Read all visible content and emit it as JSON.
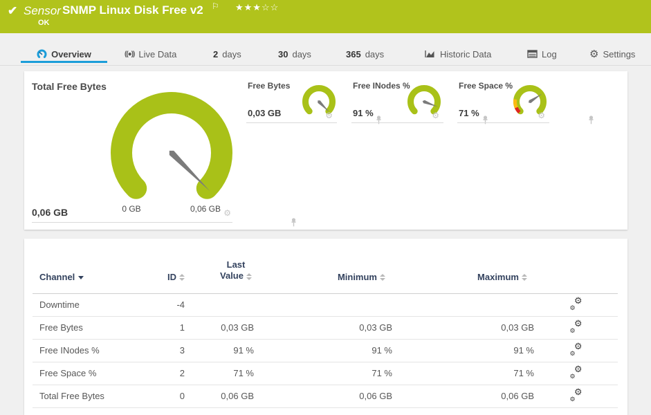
{
  "colors": {
    "brand_green": "#b1c31c",
    "accent_blue": "#1b9dd9",
    "gauge_green": "#a9c118",
    "warn_red": "#e02520",
    "warn_amber": "#fbba12",
    "needle_gray": "#7b7b7b"
  },
  "header": {
    "check_icon": "check-icon",
    "kind_label": "Sensor",
    "title": "SNMP Linux Disk Free v2",
    "flag_icon": "flag-icon",
    "stars": {
      "filled": 3,
      "total": 5
    },
    "status": "OK"
  },
  "tabs": [
    {
      "icon": "gauge-icon",
      "label": "Overview",
      "active": true
    },
    {
      "icon": "live-data-icon",
      "label": "Live Data"
    },
    {
      "prefix": "2",
      "label": "days"
    },
    {
      "prefix": "30",
      "label": "days"
    },
    {
      "prefix": "365",
      "label": "days"
    },
    {
      "icon": "historic-data-icon",
      "label": "Historic Data"
    },
    {
      "icon": "log-icon",
      "label": "Log"
    },
    {
      "icon": "settings-icon",
      "label": "Settings"
    }
  ],
  "gauges": {
    "primary": {
      "title": "Total Free Bytes",
      "value": "0,06 GB",
      "min_label": "0 GB",
      "max_label": "0,06 GB",
      "fraction": 1,
      "color": "#a9c118",
      "overlays": [],
      "footer_icons": [
        "gear-icon",
        "pin-icon"
      ]
    },
    "items": [
      {
        "title": "Free Bytes",
        "value": "0,03 GB",
        "fraction": 1,
        "color": "#a9c118",
        "overlays": [],
        "footer_icons": [
          "gear-icon",
          "pin-icon"
        ]
      },
      {
        "title": "Free INodes %",
        "value": "91 %",
        "fraction": 0.91,
        "color": "#a9c118",
        "overlays": [],
        "footer_icons": [
          "gear-icon",
          "pin-icon"
        ]
      },
      {
        "title": "Free Space %",
        "value": "71 %",
        "fraction": 0.71,
        "color": "#a9c118",
        "overlays": [
          {
            "color": "#e02520",
            "from": 0,
            "to": 0.08
          },
          {
            "color": "#fbba12",
            "from": 0.08,
            "to": 0.2
          }
        ],
        "footer_icons": [
          "gear-icon",
          "pin-icon"
        ]
      }
    ]
  },
  "table": {
    "columns": [
      {
        "label": "Channel",
        "sorted": true
      },
      {
        "label": "ID"
      },
      {
        "label": "Last Value"
      },
      {
        "label": "Minimum"
      },
      {
        "label": "Maximum"
      }
    ],
    "row_settings_icon": "channel-settings-gears-icon",
    "rows": [
      {
        "channel": "Downtime",
        "id": "-4",
        "last": "",
        "min": "",
        "max": ""
      },
      {
        "channel": "Free Bytes",
        "id": "1",
        "last": "0,03 GB",
        "min": "0,03 GB",
        "max": "0,03 GB"
      },
      {
        "channel": "Free INodes %",
        "id": "3",
        "last": "91 %",
        "min": "91 %",
        "max": "91 %"
      },
      {
        "channel": "Free Space %",
        "id": "2",
        "last": "71 %",
        "min": "71 %",
        "max": "71 %"
      },
      {
        "channel": "Total Free Bytes",
        "id": "0",
        "last": "0,06 GB",
        "min": "0,06 GB",
        "max": "0,06 GB"
      }
    ]
  }
}
